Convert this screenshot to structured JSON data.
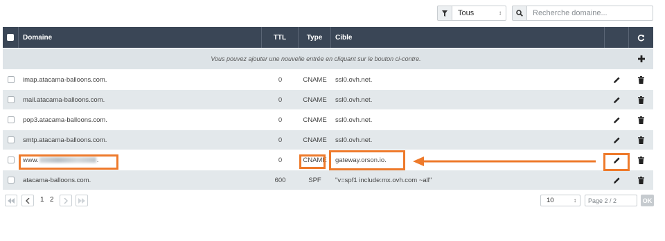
{
  "toolbar": {
    "filter_value": "Tous",
    "search_placeholder": "Recherche domaine..."
  },
  "table": {
    "headers": {
      "domain": "Domaine",
      "ttl": "TTL",
      "type": "Type",
      "target": "Cible"
    },
    "info_message": "Vous pouvez ajouter une nouvelle entrée en cliquant sur le bouton ci-contre.",
    "rows": [
      {
        "domain": "imap.atacama-balloons.com.",
        "ttl": "0",
        "type": "CNAME",
        "target": "ssl0.ovh.net."
      },
      {
        "domain": "mail.atacama-balloons.com.",
        "ttl": "0",
        "type": "CNAME",
        "target": "ssl0.ovh.net."
      },
      {
        "domain": "pop3.atacama-balloons.com.",
        "ttl": "0",
        "type": "CNAME",
        "target": "ssl0.ovh.net."
      },
      {
        "domain": "smtp.atacama-balloons.com.",
        "ttl": "0",
        "type": "CNAME",
        "target": "ssl0.ovh.net."
      },
      {
        "domain_prefix": "www.",
        "domain_suffix": ".",
        "ttl": "0",
        "type": "CNAME",
        "target": "gateway.orson.io."
      },
      {
        "domain": "atacama-balloons.com.",
        "ttl": "600",
        "type": "SPF",
        "target": "\"v=spf1 include:mx.ovh.com ~all\""
      }
    ]
  },
  "pagination": {
    "page_1": "1",
    "page_2": "2",
    "per_page": "10",
    "page_input_placeholder": "Page 2 / 2",
    "ok_label": "OK"
  },
  "colors": {
    "header_bg": "#3a4656",
    "highlight": "#ee7a2b",
    "row_alt": "#e3e8eb"
  }
}
